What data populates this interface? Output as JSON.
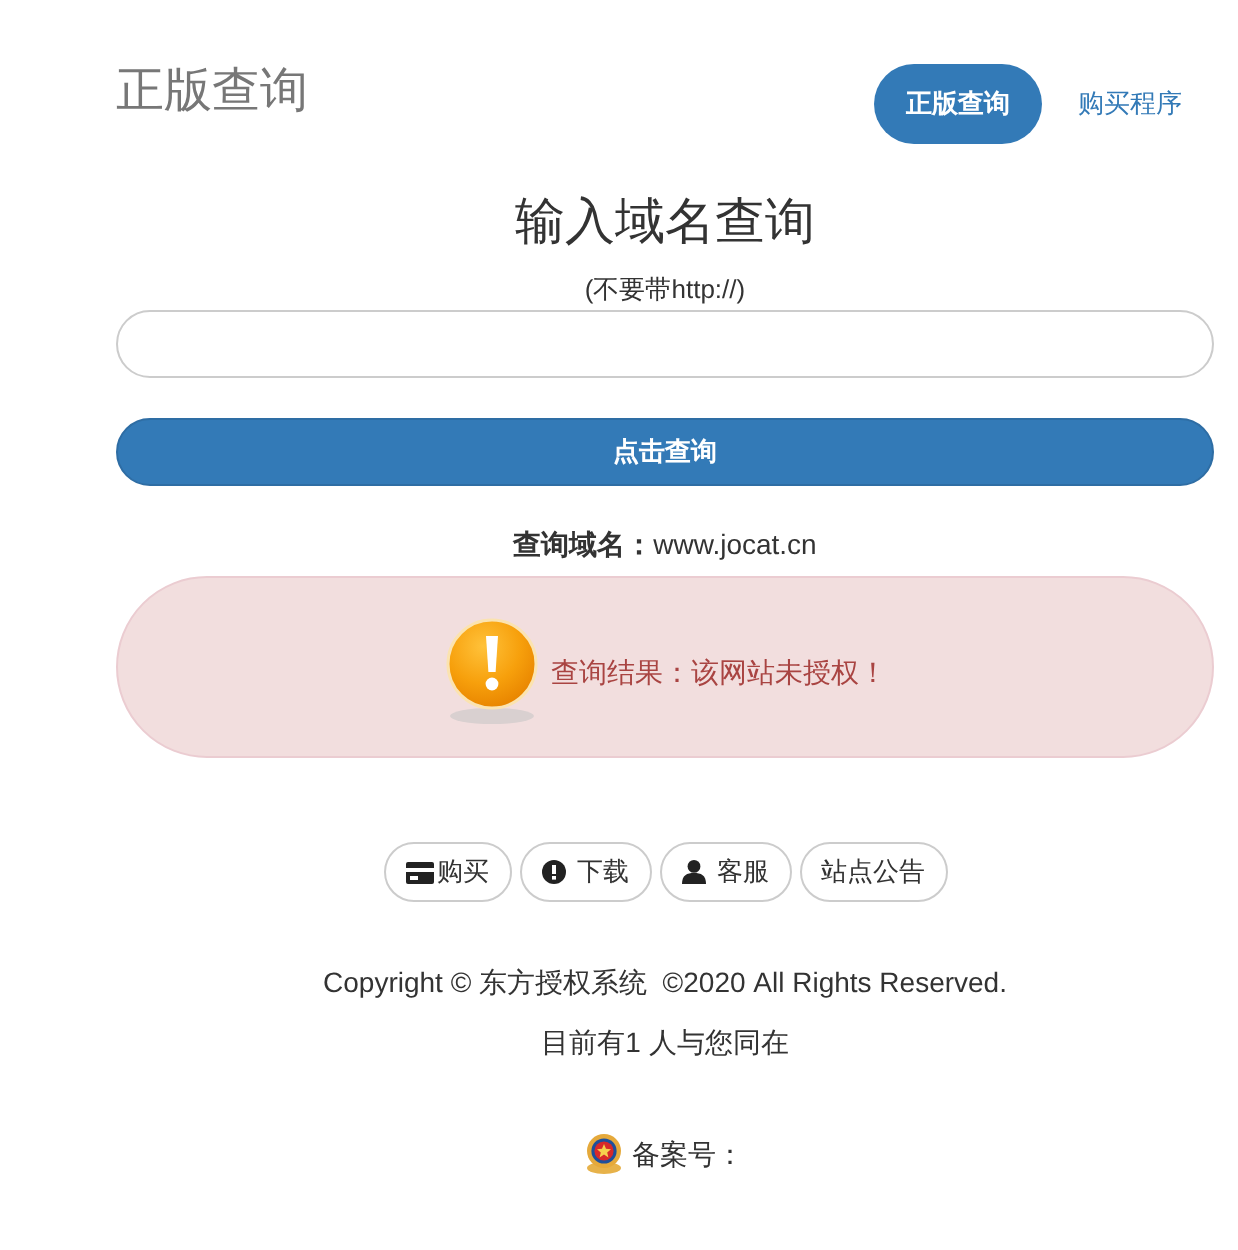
{
  "header": {
    "title": "正版查询",
    "nav": [
      {
        "label": "正版查询",
        "selected": true
      },
      {
        "label": "购买程序",
        "selected": false
      }
    ]
  },
  "query": {
    "heading": "输入域名查询",
    "hint": "(不要带http://)",
    "submit_label": "点击查询",
    "domain_line": "**查询域名：**www.jocat.cn"
  },
  "alert": {
    "kind": "danger",
    "text": "查询结果：该网站未授权！"
  },
  "actions": [
    {
      "kind": "buy",
      "label": "购买"
    },
    {
      "kind": "download",
      "label": "下载"
    },
    {
      "kind": "support",
      "label": "客服"
    },
    {
      "kind": "notice",
      "label": "站点公告"
    }
  ],
  "footer": {
    "copyright": "Copyright © 东方授权系统  ©2020 All Rights Reserved.",
    "online": "目前有1 人与您同在",
    "icp_label": "备案号："
  }
}
